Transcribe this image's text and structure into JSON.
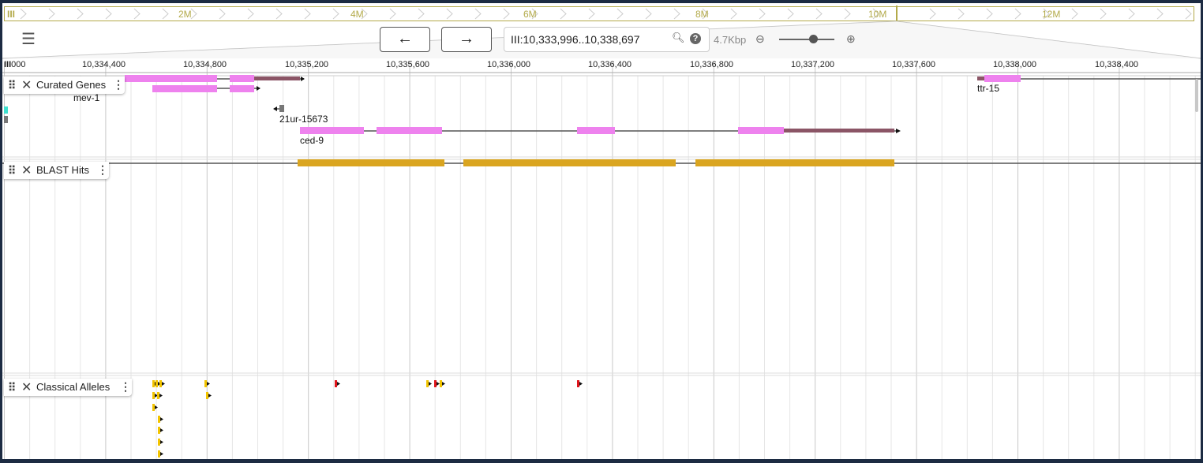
{
  "overview": {
    "ref_marker": "III",
    "labels": [
      "2M",
      "4M",
      "6M",
      "8M",
      "10M",
      "12M"
    ],
    "color": "#b3aa4a"
  },
  "toolbar": {
    "menu_icon": "list-icon",
    "back_icon": "arrow-left-icon",
    "forward_icon": "arrow-right-icon",
    "location_value": "III:10,333,996..10,338,697",
    "search_icon": "search-icon",
    "help_icon": "help-icon",
    "help_glyph": "?",
    "span": "4.7Kbp",
    "zoom_out_icon": "zoom-out-icon",
    "zoom_in_icon": "zoom-in-icon",
    "zoom_level": 0.63
  },
  "ruler": {
    "ref_prefix": "III",
    "first_label": "000",
    "ticks": [
      "10,334,400",
      "10,334,800",
      "10,335,200",
      "10,335,600",
      "10,336,000",
      "10,336,400",
      "10,336,800",
      "10,337,200",
      "10,337,600",
      "10,338,000",
      "10,338,400"
    ]
  },
  "tracks": [
    {
      "name": "Curated Genes",
      "id": "curated-genes"
    },
    {
      "name": "BLAST Hits",
      "id": "blast-hits"
    },
    {
      "name": "Classical Alleles",
      "id": "classical-alleles"
    }
  ],
  "features": {
    "genes": [
      "mev-1",
      "21ur-15673",
      "ced-9",
      "ttr-15"
    ]
  },
  "colors": {
    "exon": "#ee82ee",
    "utr": "#8b5566",
    "blast": "#daa520",
    "allele_yellow": "#f2c400",
    "allele_red": "#e0141b",
    "teal": "#40e0d0"
  }
}
